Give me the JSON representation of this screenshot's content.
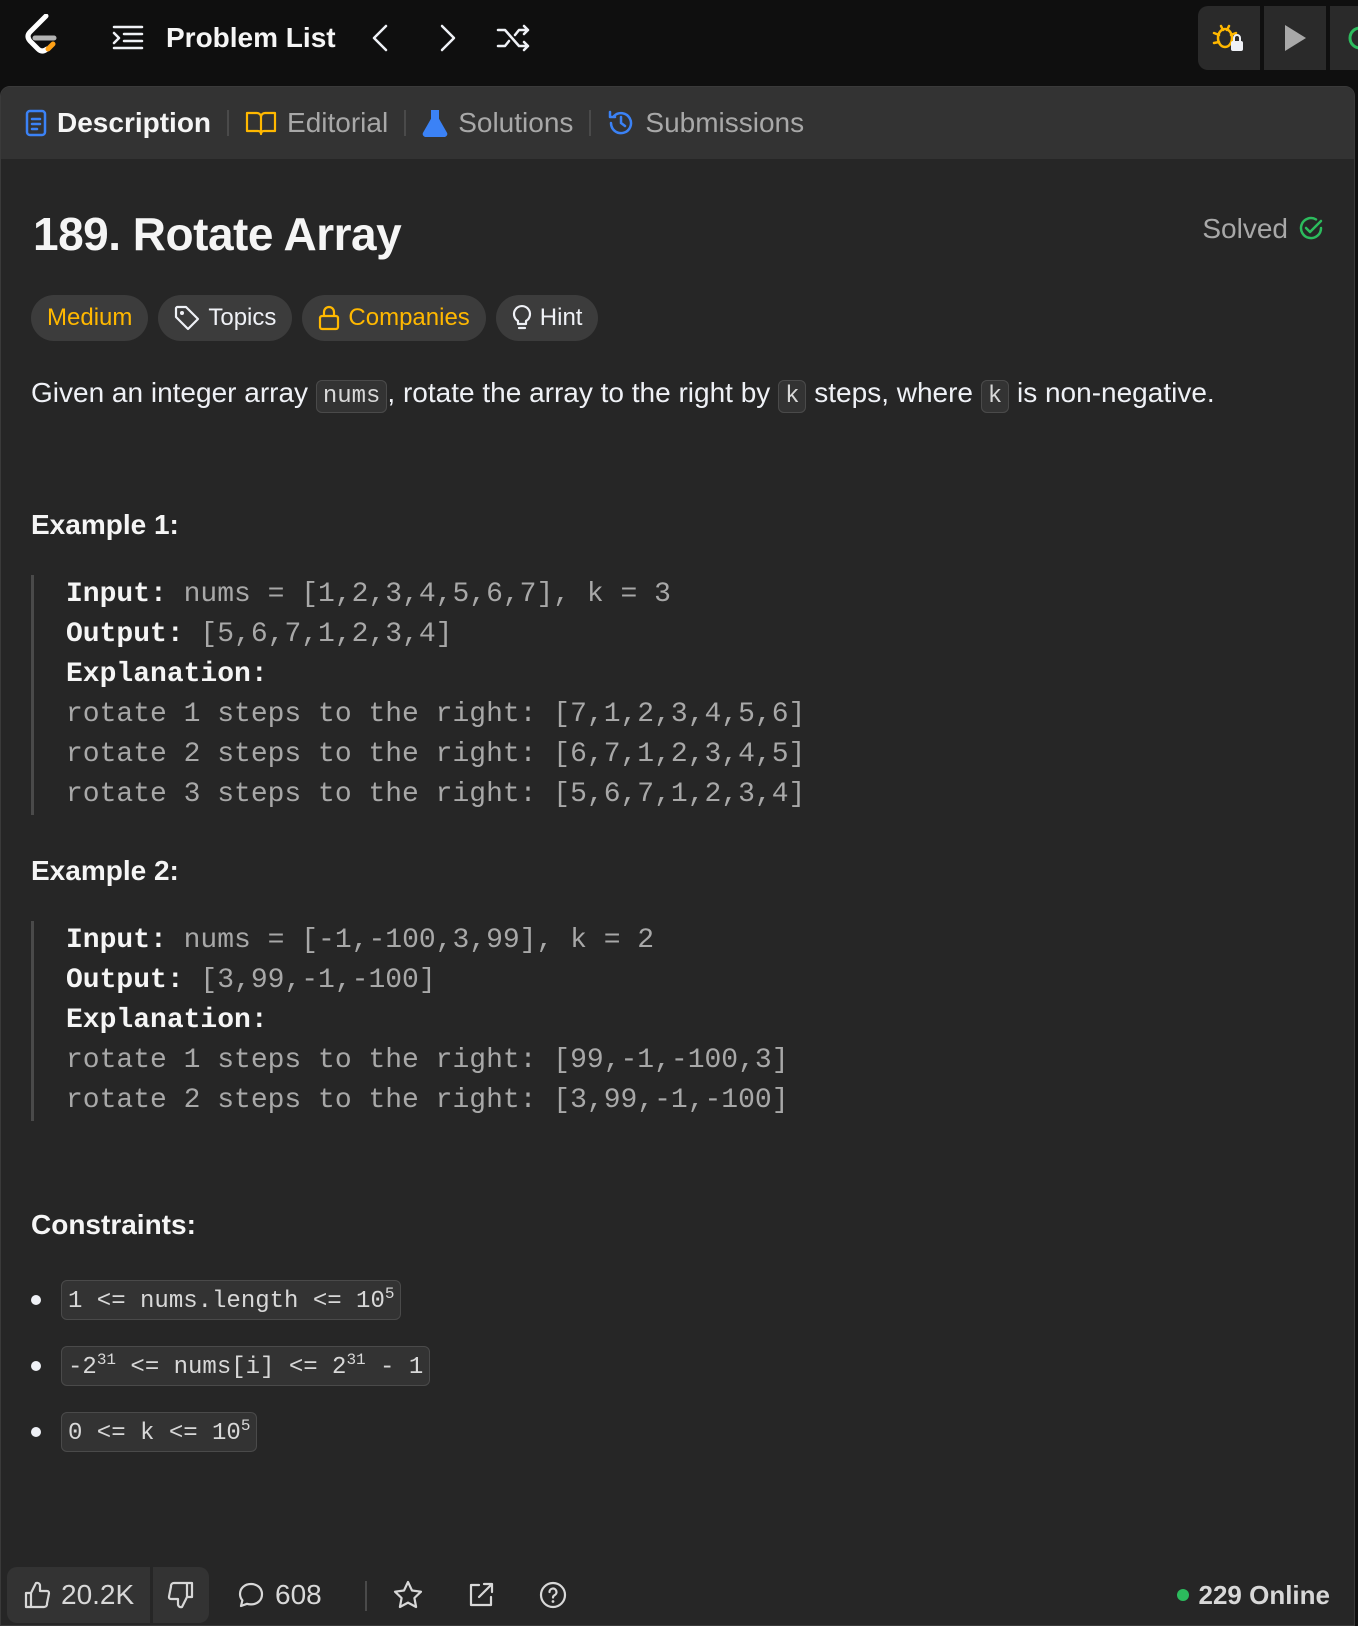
{
  "topbar": {
    "problem_list_label": "Problem List"
  },
  "tabs": [
    {
      "label": "Description"
    },
    {
      "label": "Editorial"
    },
    {
      "label": "Solutions"
    },
    {
      "label": "Submissions"
    }
  ],
  "problem": {
    "title": "189. Rotate Array",
    "status": "Solved",
    "difficulty": "Medium",
    "chips": {
      "topics": "Topics",
      "companies": "Companies",
      "hint": "Hint"
    },
    "description": {
      "part1": "Given an integer array ",
      "code1": "nums",
      "part2": ", rotate the array to the right by ",
      "code2": "k",
      "part3": " steps, where ",
      "code3": "k",
      "part4": " is non-negative."
    }
  },
  "examples": [
    {
      "heading": "Example 1:",
      "input_label": "Input:",
      "input": " nums = [1,2,3,4,5,6,7], k = 3",
      "output_label": "Output:",
      "output": " [5,6,7,1,2,3,4]",
      "explanation_label": "Explanation:",
      "lines": [
        "rotate 1 steps to the right: [7,1,2,3,4,5,6]",
        "rotate 2 steps to the right: [6,7,1,2,3,4,5]",
        "rotate 3 steps to the right: [5,6,7,1,2,3,4]"
      ]
    },
    {
      "heading": "Example 2:",
      "input_label": "Input:",
      "input": " nums = [-1,-100,3,99], k = 2",
      "output_label": "Output:",
      "output": " [3,99,-1,-100]",
      "explanation_label": "Explanation:",
      "lines": [
        "rotate 1 steps to the right: [99,-1,-100,3]",
        "rotate 2 steps to the right: [3,99,-1,-100]"
      ]
    }
  ],
  "constraints": {
    "heading": "Constraints:",
    "items": [
      {
        "a": "1 <= nums.length <= 10",
        "sup": "5",
        "b": ""
      },
      {
        "a": "-2",
        "sup": "31",
        "mid": " <= nums[i] <= 2",
        "sup2": "31",
        "b": " - 1"
      },
      {
        "a": "0 <= k <= 10",
        "sup": "5",
        "b": ""
      }
    ]
  },
  "bottombar": {
    "likes": "20.2K",
    "comments": "608",
    "online": "229 Online"
  },
  "colors": {
    "accent_orange": "#ffb800",
    "success_green": "#2cbb5d",
    "tab_blue": "#3b82f6"
  }
}
